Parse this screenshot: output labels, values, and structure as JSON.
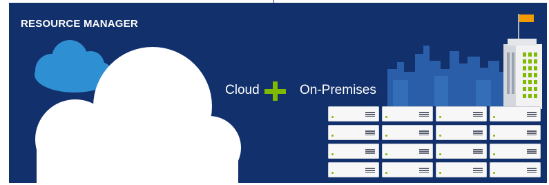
{
  "banner": {
    "title": "RESOURCE MANAGER",
    "background_color": "#12306b",
    "label_left": "Cloud",
    "label_right": "On-Premises",
    "plus_color": "#7fba00"
  },
  "illustration": {
    "clouds": [
      "cloud-large-white",
      "cloud-small-blue"
    ],
    "skyline": "city-skyline",
    "building": "office-building-with-flag",
    "server_rack": {
      "rows": 4,
      "columns": 4
    }
  }
}
